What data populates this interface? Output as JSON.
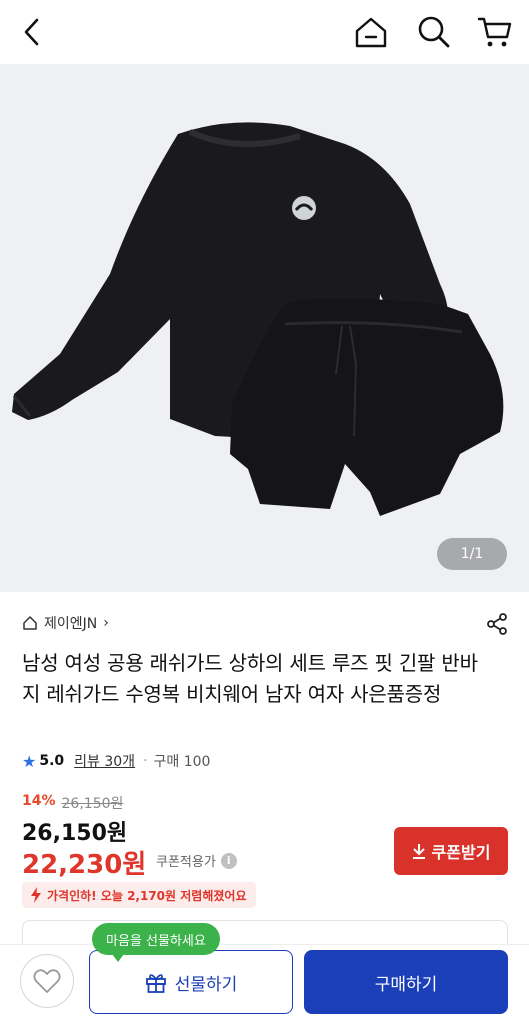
{
  "header": {
    "back_icon": "chevron-left-icon",
    "home_icon": "home-icon",
    "search_icon": "search-icon",
    "cart_icon": "cart-icon"
  },
  "gallery": {
    "counter": "1/1"
  },
  "store": {
    "name": "제이엔JN",
    "chevron": "›"
  },
  "product": {
    "title": "남성 여성 공용 래쉬가드 상하의 세트 루즈 핏 긴팔 반바지 레쉬가드 수영복 비치웨어 남자 여자 사은품증정",
    "rating": "5.0",
    "reviews": "리뷰 30개",
    "separator": "·",
    "sold": "구매 100"
  },
  "pricing": {
    "discount_rate": "14%",
    "original_price": "26,150원",
    "price": "26,150원",
    "coupon_price": "22,230원",
    "coupon_note": "쿠폰적용가",
    "info_mark": "i",
    "coupon_button": "쿠폰받기",
    "price_drop": "가격인하! 오늘 2,170원 저렴해졌어요"
  },
  "bottom": {
    "tooltip": "마음을 선물하세요",
    "gift_button": "선물하기",
    "buy_button": "구매하기"
  },
  "colors": {
    "accent": "#1a3fb8",
    "price_red": "#e0352b",
    "tooltip_green": "#3cb24a"
  }
}
